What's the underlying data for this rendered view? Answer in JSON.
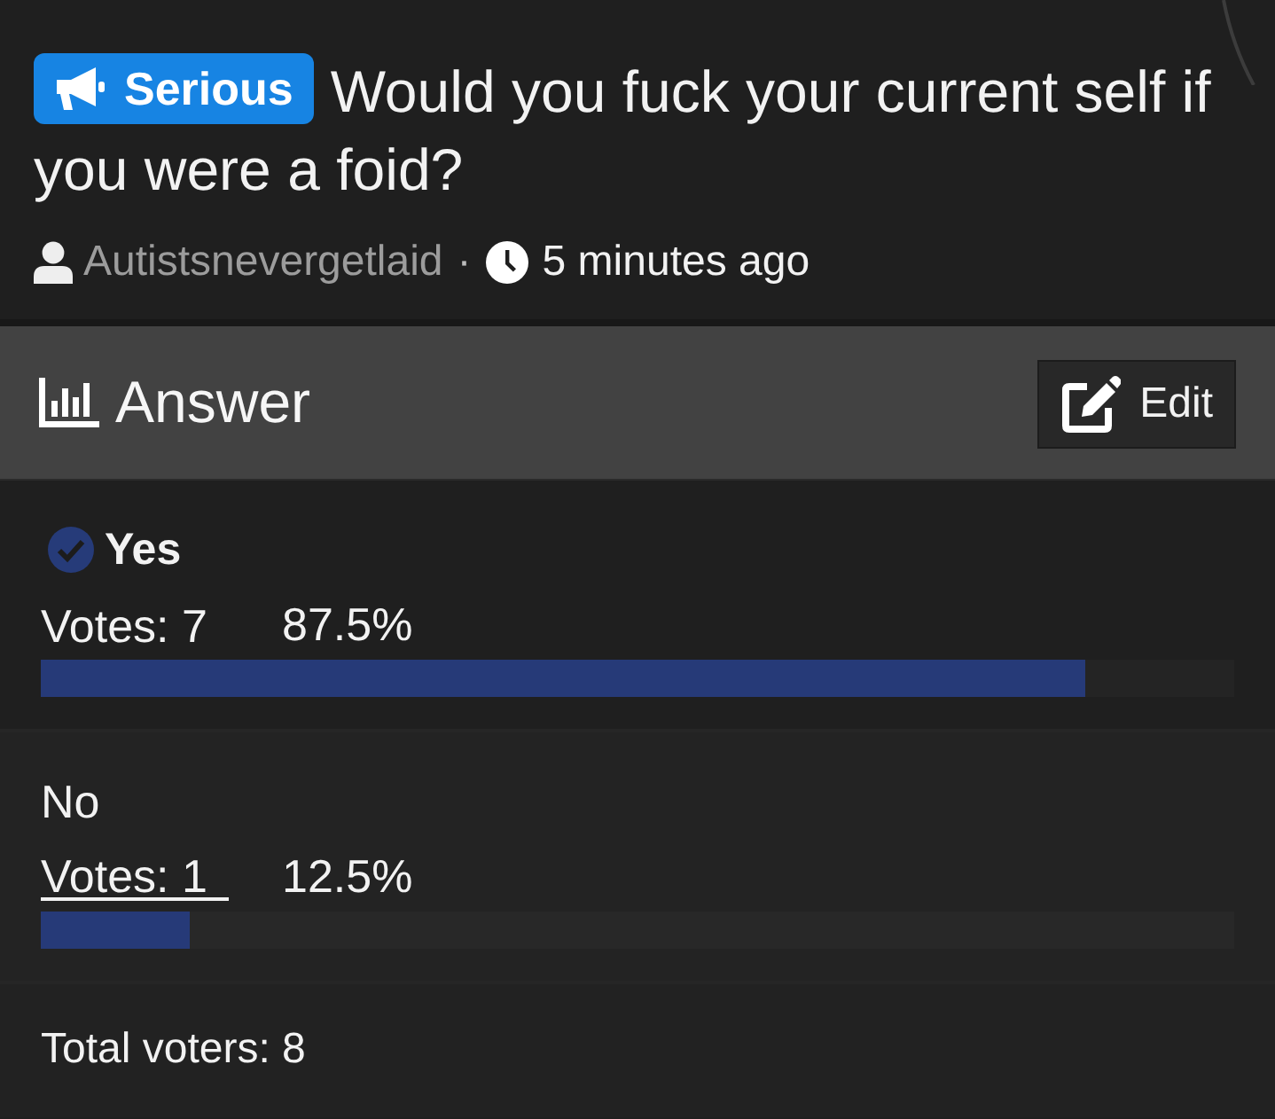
{
  "post": {
    "tag": "Serious",
    "title_lines": [
      "Would you fuck your current self if",
      "you were a foid?"
    ],
    "author": "Autistsnevergetlaid",
    "separator": "·",
    "time": "5 minutes ago"
  },
  "poll": {
    "header": "Answer",
    "edit_button": "Edit",
    "options": [
      {
        "label": "Yes",
        "selected": true,
        "votes": "Votes: 7",
        "votes_hovered": false,
        "percent": "87.5%",
        "level": 0.875
      },
      {
        "label": "No",
        "selected": false,
        "votes": "Votes: 1",
        "votes_hovered": true,
        "percent": "12.5%",
        "level": 0.125
      }
    ],
    "total": "Total voters: 8"
  }
}
